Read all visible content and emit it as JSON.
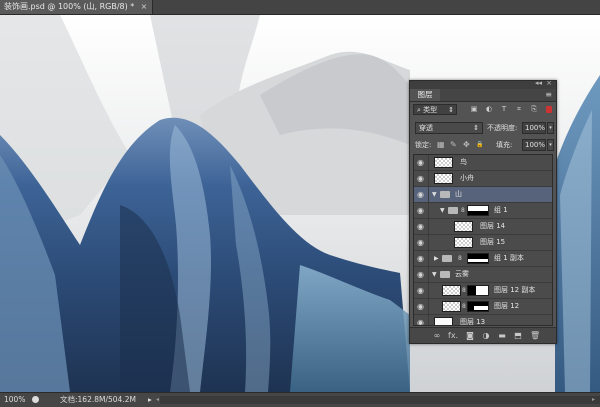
{
  "document_tab": {
    "title": "装饰画.psd @ 100% (山, RGB/8) *",
    "close": "×"
  },
  "status": {
    "zoom": "100%",
    "doc_info": "文档:162.8M/504.2M",
    "arrow": "▸",
    "scroll_left": "◂",
    "scroll_right": "▸"
  },
  "panel": {
    "collapse": "◂◂",
    "close": "×",
    "tab": "图层",
    "menu": "≡",
    "filter": {
      "kind": "类型",
      "search_icon": "⌕",
      "dropdown": "⇕",
      "icons": [
        "▣",
        "◐",
        "T",
        "⌗",
        "⎘"
      ]
    },
    "blend_mode": "穿透",
    "blend_dropdown": "⇕",
    "opacity_label": "不透明度:",
    "opacity": "100%",
    "lock_label": "锁定:",
    "lock_icons": [
      "▦",
      "✎",
      "✥",
      "🔒"
    ],
    "fill_label": "填充:",
    "fill": "100%",
    "slider_button": "▾",
    "layers": [
      {
        "name": "鸟",
        "eye": "◉",
        "type": "layer"
      },
      {
        "name": "小舟",
        "eye": "◉",
        "type": "layer"
      },
      {
        "name": "山",
        "eye": "◉",
        "type": "group",
        "expanded": "▼",
        "selected": true
      },
      {
        "name": "组 1",
        "eye": "◉",
        "type": "group-mask",
        "expanded": "▼"
      },
      {
        "name": "图层 14",
        "eye": "◉",
        "type": "layer"
      },
      {
        "name": "图层 15",
        "eye": "◉",
        "type": "layer"
      },
      {
        "name": "组 1 副本",
        "eye": "◉",
        "type": "group-mask",
        "expanded": "▶"
      },
      {
        "name": "云雾",
        "eye": "◉",
        "type": "group",
        "expanded": "▼"
      },
      {
        "name": "图层 12 副本",
        "eye": "◉",
        "type": "layer-mask"
      },
      {
        "name": "图层 12",
        "eye": "◉",
        "type": "layer-mask"
      },
      {
        "name": "图层 13",
        "eye": "◉",
        "type": "layer-white"
      }
    ],
    "bottom_icons": [
      "∞",
      "fx.",
      "◙",
      "◑",
      "▬",
      "⬒",
      "🗑"
    ]
  },
  "colors": {
    "selected_row": "#56637a",
    "panel_bg": "#535353",
    "mountain_blue": "#3d5f8c"
  }
}
